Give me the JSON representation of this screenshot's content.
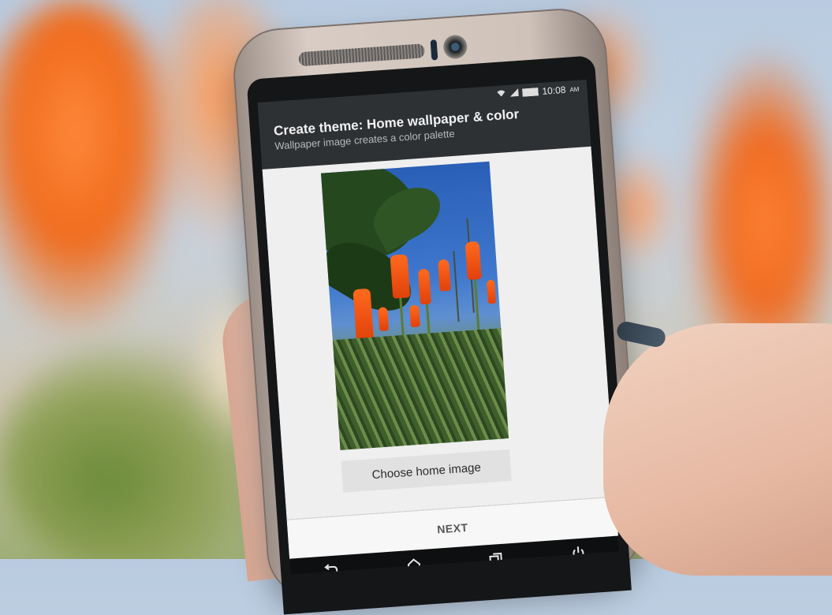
{
  "screen": {
    "status": {
      "time": "10:08",
      "ampm": "AM",
      "icons": [
        "wifi-icon",
        "signal-icon",
        "battery-icon"
      ]
    },
    "appbar": {
      "title": "Create theme: Home wallpaper & color",
      "subtitle": "Wallpaper image creates a color palette"
    },
    "choose_button": "Choose home image",
    "next_button": "NEXT",
    "nav_icons": [
      "back-icon",
      "home-icon",
      "recents-icon",
      "power-icon"
    ]
  },
  "colors": {
    "accent_orange": "#f06a1a",
    "screen_bg": "#efefef",
    "appbar_bg": "#2e3134"
  }
}
